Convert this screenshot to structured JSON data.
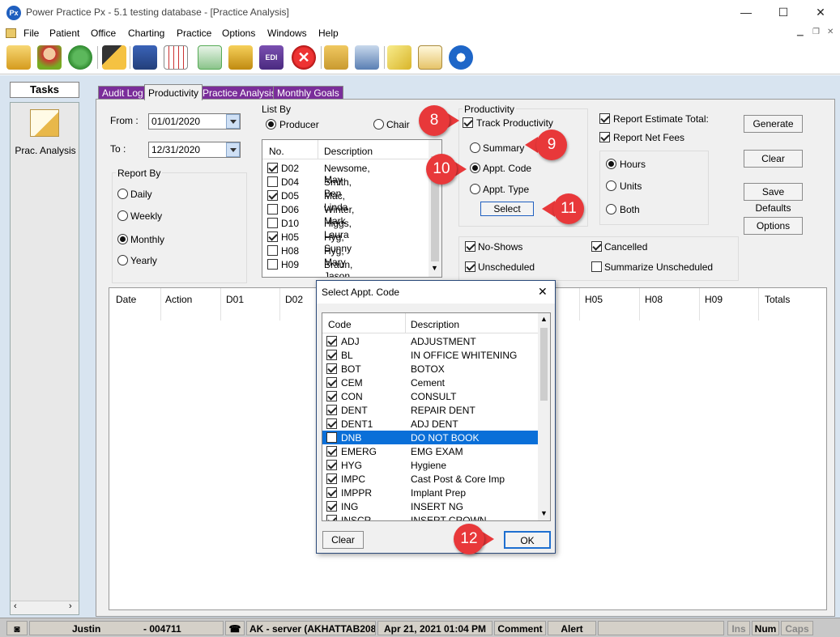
{
  "window": {
    "title": "Power Practice Px - 5.1 testing database - [Practice Analysis]",
    "app_icon_text": "Px",
    "minimize": "—",
    "maximize": "☐",
    "close": "✕"
  },
  "menu": [
    "File",
    "Patient",
    "Office",
    "Charting",
    "Practice",
    "Options",
    "Windows",
    "Help"
  ],
  "tasks": {
    "title": "Tasks",
    "item_label": "Prac. Analysis"
  },
  "tabs": [
    "Audit Log",
    "Productivity",
    "Practice Analysis",
    "Monthly Goals"
  ],
  "dates": {
    "from_label": "From :",
    "from_value": "01/01/2020",
    "to_label": "To :",
    "to_value": "12/31/2020"
  },
  "report_by": {
    "label": "Report By",
    "options": [
      "Daily",
      "Weekly",
      "Monthly",
      "Yearly"
    ],
    "selected": "Monthly"
  },
  "list_by": {
    "label": "List By",
    "producer": "Producer",
    "chair": "Chair",
    "col_no": "No.",
    "col_desc": "Description",
    "rows": [
      {
        "no": "D02",
        "desc": "Newsome, May",
        "checked": true
      },
      {
        "no": "D04",
        "desc": "Smith, Ben",
        "checked": false
      },
      {
        "no": "D05",
        "desc": "Mac, Linda",
        "checked": true
      },
      {
        "no": "D06",
        "desc": "Winter, Mark",
        "checked": false
      },
      {
        "no": "D10",
        "desc": "Higgs, Laura",
        "checked": false
      },
      {
        "no": "H05",
        "desc": "Hyg, Sunny",
        "checked": true
      },
      {
        "no": "H08",
        "desc": "Hyg, Mary",
        "checked": false
      },
      {
        "no": "H09",
        "desc": "Braun, Jason",
        "checked": false
      }
    ]
  },
  "productivity": {
    "label": "Productivity",
    "track": "Track Productivity",
    "summary": "Summary",
    "appt_code": "Appt. Code",
    "appt_type": "Appt. Type",
    "select_btn": "Select"
  },
  "report_opts": {
    "estimate_total": "Report Estimate Total:",
    "net_fees": "Report Net Fees",
    "hours": "Hours",
    "units": "Units",
    "both": "Both"
  },
  "buttons": {
    "generate": "Generate",
    "clear": "Clear",
    "save_defaults": "Save Defaults",
    "options": "Options"
  },
  "extras": {
    "no_shows": "No-Shows",
    "cancelled": "Cancelled",
    "unscheduled": "Unscheduled",
    "summarize_unscheduled": "Summarize Unscheduled"
  },
  "grid": {
    "columns": [
      "Date",
      "Action",
      "D01",
      "D02",
      "H05",
      "H08",
      "H09",
      "Totals"
    ]
  },
  "dialog": {
    "title": "Select Appt. Code",
    "col_code": "Code",
    "col_desc": "Description",
    "rows": [
      {
        "code": "ADJ",
        "desc": "ADJUSTMENT",
        "checked": true
      },
      {
        "code": "BL",
        "desc": "IN OFFICE WHITENING",
        "checked": true
      },
      {
        "code": "BOT",
        "desc": "BOTOX",
        "checked": true
      },
      {
        "code": "CEM",
        "desc": "Cement",
        "checked": true
      },
      {
        "code": "CON",
        "desc": "CONSULT",
        "checked": true
      },
      {
        "code": "DENT",
        "desc": "REPAIR DENT",
        "checked": true
      },
      {
        "code": "DENT1",
        "desc": "ADJ DENT",
        "checked": true
      },
      {
        "code": "DNB",
        "desc": "DO NOT BOOK",
        "checked": false
      },
      {
        "code": "EMERG",
        "desc": "EMG EXAM",
        "checked": true
      },
      {
        "code": "HYG",
        "desc": "Hygiene",
        "checked": true
      },
      {
        "code": "IMPC",
        "desc": "Cast Post & Core Imp",
        "checked": true
      },
      {
        "code": "IMPPR",
        "desc": "Implant Prep",
        "checked": true
      },
      {
        "code": "ING",
        "desc": "INSERT NG",
        "checked": true
      },
      {
        "code": "INSCR",
        "desc": "INSERT CROWN",
        "checked": true
      }
    ],
    "clear_btn": "Clear",
    "ok_btn": "OK"
  },
  "callouts": [
    "8",
    "9",
    "10",
    "11",
    "12"
  ],
  "status": {
    "user": "Justin",
    "id": "- 004711",
    "server": "AK - server (AKHATTAB208",
    "datetime": "Apr 21, 2021  01:04 PM",
    "comment": "Comment",
    "alert": "Alert",
    "ins": "Ins",
    "num": "Num",
    "caps": "Caps"
  },
  "colors": {
    "tab_purple": "#7a2d9a",
    "panel_bg": "#d8e4f0",
    "callout_red": "#e8383a",
    "selection": "#0a6fd8"
  }
}
